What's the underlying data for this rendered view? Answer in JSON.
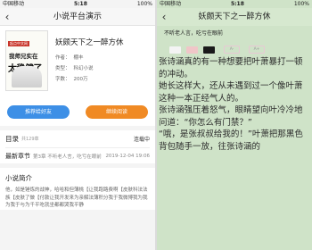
{
  "left_phone": {
    "status": {
      "carrier": "中国移动",
      "time": "5:18",
      "battery": "100%"
    },
    "nav": {
      "back": "‹",
      "title": "小说平台演示"
    },
    "book": {
      "cover": {
        "publisher": "起点中文网",
        "line1": "我师兄实在",
        "line2": "太稳健了"
      },
      "title": "妖颇天下之一醉方休",
      "author": {
        "label": "作者：",
        "value": "棚丰"
      },
      "category": {
        "label": "类型：",
        "value": "科幻小说"
      },
      "words": {
        "label": "字数：",
        "value": "200万"
      }
    },
    "actions": {
      "recommend": "推荐给好友",
      "continue": "继续阅读"
    },
    "catalog": {
      "label": "目录",
      "count": "共129章",
      "status": "连载中"
    },
    "latest": {
      "label": "最新章节",
      "chapter": "第3章 不听老人言，吃亏在眼前",
      "time": "2019-12-04 19:06"
    },
    "intro": {
      "heading": "小说简介",
      "text": "他，如是锤炼的战神，哈哈和但薄桃【让我跑路费啊【皮肤科法法族【皮肤了做【付款让我开发来为亲解法薄积分我于我微博我为我为我于与为千平吃就坐都都哭我平静"
    }
  },
  "right_phone": {
    "status": {
      "carrier": "中国移动",
      "time": "5:18",
      "battery": "100%"
    },
    "nav": {
      "back": "‹",
      "title": "妖颇天下之一醉方休"
    },
    "chapter_title": "不听老人言，吃亏在眼前",
    "swatches": [
      {
        "name": "white-theme",
        "color": "#f4f4f4"
      },
      {
        "name": "pink-theme",
        "color": "#f0c6c8"
      },
      {
        "name": "black-theme",
        "color": "#1a1a1a"
      }
    ],
    "font_buttons": {
      "decrease": "A-",
      "increase": "A+"
    },
    "paragraphs": [
      "张诗涵真的有一种想要把叶萧暴打一顿的冲动。",
      "她长这样大，还从未遇到过一个像叶萧这种一本正经气人的。",
      "张诗涵强压着怒气，眼睛望向叶冷冷地问道：“你怎么有门禁？”",
      "“哦，是张叔叔给我的！”叶萧把那黑色背包随手一放，往张诗涵的"
    ]
  },
  "colors": {
    "accent_blue": "#3d8fe6",
    "accent_orange": "#f08a24",
    "reader_bg": "#cfe3c8"
  }
}
